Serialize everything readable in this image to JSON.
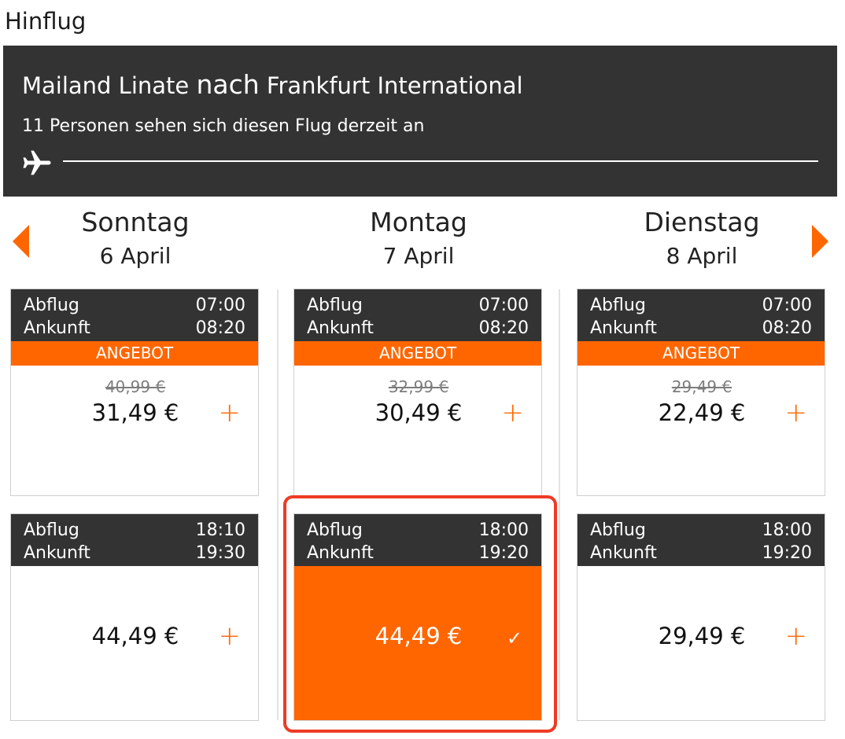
{
  "section_title": "Hinflug",
  "banner": {
    "origin": "Mailand Linate",
    "connector": "nach",
    "destination": "Frankfurt International",
    "viewers_text": "11 Personen sehen sich diesen Flug derzeit an"
  },
  "days": [
    {
      "name": "Sonntag",
      "date": "6 April"
    },
    {
      "name": "Montag",
      "date": "7 April"
    },
    {
      "name": "Dienstag",
      "date": "8 April"
    }
  ],
  "labels": {
    "departure": "Abflug",
    "arrival": "Ankunft",
    "offer": "ANGEBOT",
    "add": "+",
    "selected": "✓"
  },
  "flights": {
    "sunday_morning": {
      "dep": "07:00",
      "arr": "08:20",
      "old_price": "40,99 €",
      "price": "31,49 €"
    },
    "monday_morning": {
      "dep": "07:00",
      "arr": "08:20",
      "old_price": "32,99 €",
      "price": "30,49 €"
    },
    "tuesday_morning": {
      "dep": "07:00",
      "arr": "08:20",
      "old_price": "29,49 €",
      "price": "22,49 €"
    },
    "sunday_evening": {
      "dep": "18:10",
      "arr": "19:30",
      "price": "44,49 €"
    },
    "monday_evening": {
      "dep": "18:00",
      "arr": "19:20",
      "price": "44,49 €",
      "selected": true
    },
    "tuesday_evening": {
      "dep": "18:00",
      "arr": "19:20",
      "price": "29,49 €"
    }
  },
  "colors": {
    "accent": "#ff6600",
    "dark": "#333333",
    "highlight": "#ee3b24"
  }
}
